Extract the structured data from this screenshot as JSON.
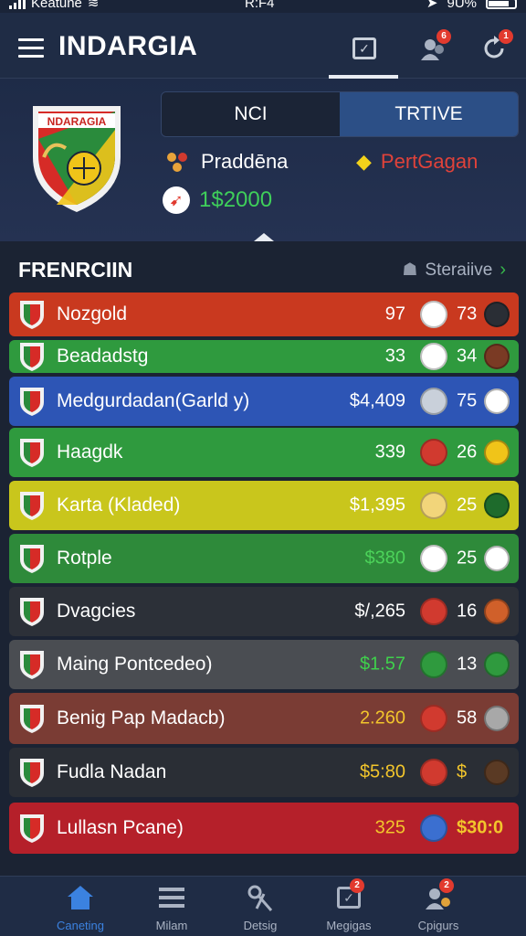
{
  "status_bar": {
    "carrier": "Keatune",
    "time": "R:F4",
    "battery": "9U%"
  },
  "header": {
    "title": "INDARGIA",
    "notif_badge": "6",
    "alert_badge": "1"
  },
  "hero": {
    "crest_text": "NDARAGIA",
    "tabs": [
      "NCI",
      "TRTIVE"
    ],
    "player_label": "Praddēna",
    "rival_label": "PertGagan",
    "amount": "1$2000"
  },
  "list": {
    "title": "FRENRCIIN",
    "link": "Steraiive",
    "rows": [
      {
        "name": "Nozgold",
        "value": "97",
        "num": "73",
        "bg": "#c9391f",
        "val_color": "#ffffff"
      },
      {
        "name": "Beadadstg",
        "value": "33",
        "num": "34",
        "bg": "#2f9a3e",
        "val_color": "#ffffff"
      },
      {
        "name": "Medgurdadan(Garld y)",
        "value": "$4,409",
        "num": "75",
        "bg": "#2d55b5",
        "val_color": "#ffffff"
      },
      {
        "name": "Haagdk",
        "value": "339",
        "num": "26",
        "bg": "#2f9a3e",
        "val_color": "#ffffff"
      },
      {
        "name": "Karta (Kladed)",
        "value": "$1,395",
        "num": "25",
        "bg": "#c9c61c",
        "val_color": "#ffffff"
      },
      {
        "name": "Rotple",
        "value": "$380",
        "num": "25",
        "bg": "#2e8a3a",
        "val_color": "#4cd35a"
      },
      {
        "name": "Dvagcies",
        "value": "$/,265",
        "num": "16",
        "bg": "#2c3038",
        "val_color": "#ffffff"
      },
      {
        "name": "Maing Pontcedeo)",
        "value": "$1.57",
        "num": "13",
        "bg": "#4a4d52",
        "val_color": "#3fd04c"
      },
      {
        "name": "Benig Pap Madacb)",
        "value": "2.260",
        "num": "58",
        "bg": "#7a3c34",
        "val_color": "#f2c52c"
      },
      {
        "name": "Fudla Nadan",
        "value": "$5:80",
        "num": "$",
        "bg": "#2a2e35",
        "val_color": "#f2c52c"
      },
      {
        "name": "Lullasn Pcane)",
        "value": "325",
        "num": "$30:0",
        "bg": "#b5202a",
        "val_color": "#f2c52c"
      }
    ]
  },
  "bottom_nav": [
    {
      "label": "Caneting",
      "badge": ""
    },
    {
      "label": "Milam",
      "badge": ""
    },
    {
      "label": "Detsig",
      "badge": ""
    },
    {
      "label": "Megigas",
      "badge": "2"
    },
    {
      "label": "Cpigurs",
      "badge": "2"
    }
  ],
  "colors": {
    "header": "#1f2c45",
    "accent": "#3b82e0",
    "positive": "#36b84b"
  }
}
